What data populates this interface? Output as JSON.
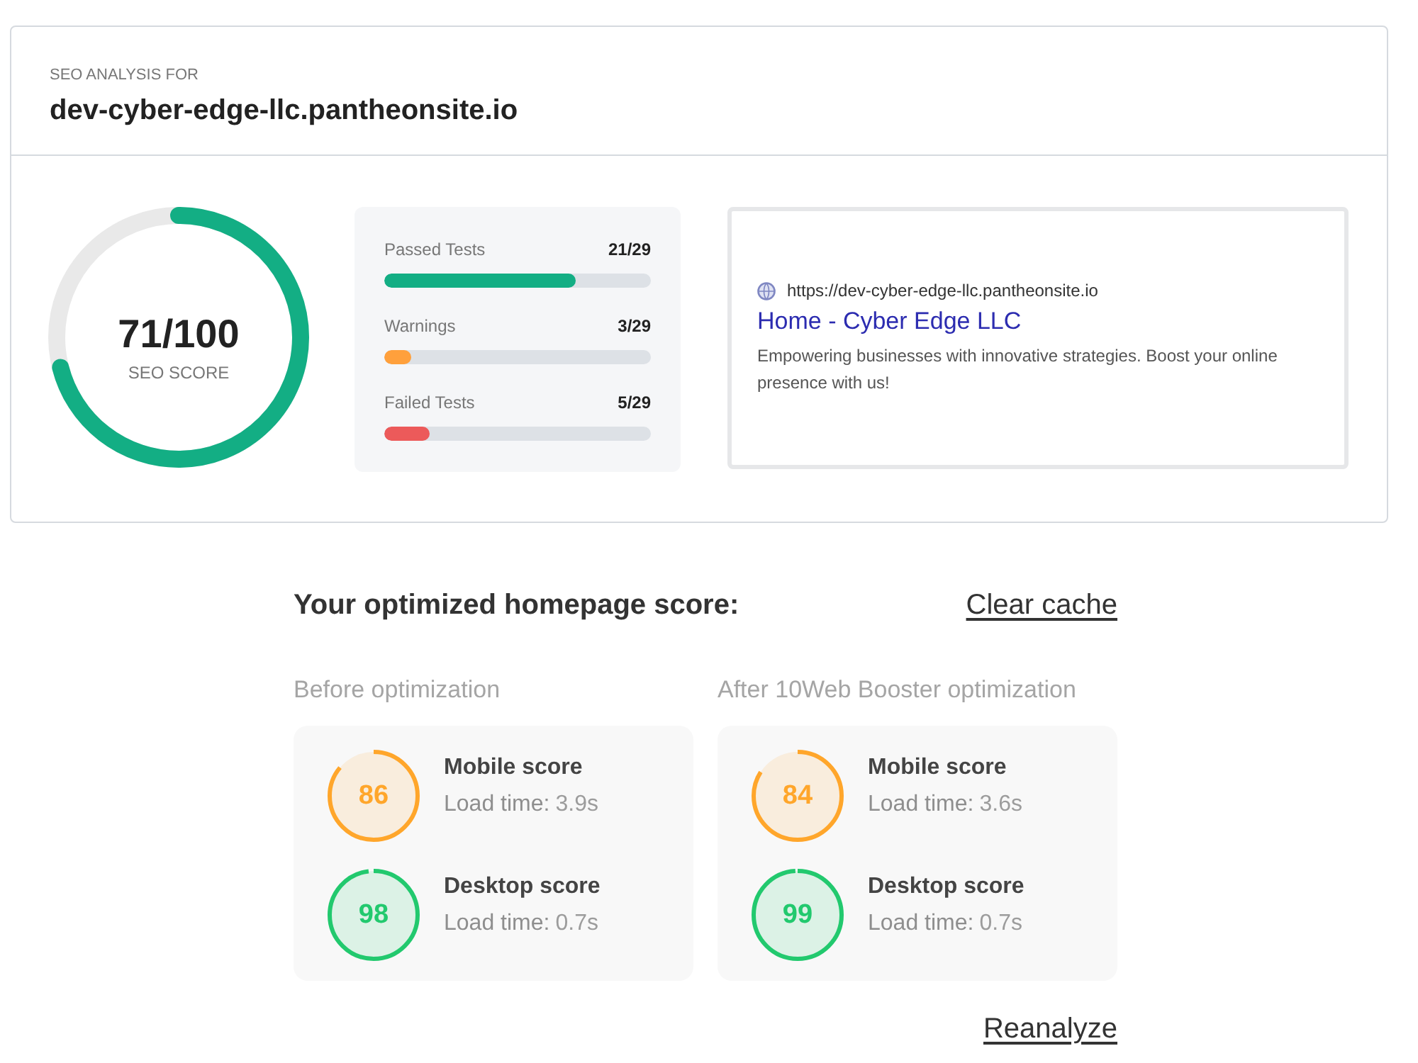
{
  "header": {
    "label": "SEO ANALYSIS FOR",
    "domain": "dev-cyber-edge-llc.pantheonsite.io"
  },
  "seo_score": {
    "value": "71/100",
    "label": "SEO SCORE",
    "level": 0.71
  },
  "stats": [
    {
      "label": "Passed Tests",
      "value": "21/29",
      "level": 0.72,
      "color": "#13ae84"
    },
    {
      "label": "Warnings",
      "value": "3/29",
      "level": 0.1,
      "color": "#ffa03c"
    },
    {
      "label": "Failed Tests",
      "value": "5/29",
      "level": 0.17,
      "color": "#ec5a5a"
    }
  ],
  "search_preview": {
    "url": "https://dev-cyber-edge-llc.pantheonsite.io",
    "title": "Home - Cyber Edge LLC",
    "description": "Empowering businesses with innovative strategies. Boost your online presence with us!"
  },
  "optimized": {
    "title": "Your optimized homepage score:",
    "clear_cache": "Clear cache",
    "columns": [
      {
        "heading": "Before optimization",
        "scores": [
          {
            "score": "86",
            "level": 0.86,
            "color": "#ffa62b",
            "label": "Mobile score",
            "load_time_label": "Load time:",
            "load_time": "3.9s"
          },
          {
            "score": "98",
            "level": 0.98,
            "color": "#22c96e",
            "label": "Desktop score",
            "load_time_label": "Load time:",
            "load_time": "0.7s"
          }
        ]
      },
      {
        "heading": "After 10Web Booster optimization",
        "scores": [
          {
            "score": "84",
            "level": 0.84,
            "color": "#ffa62b",
            "label": "Mobile score",
            "load_time_label": "Load time:",
            "load_time": "3.6s"
          },
          {
            "score": "99",
            "level": 0.99,
            "color": "#22c96e",
            "label": "Desktop score",
            "load_time_label": "Load time:",
            "load_time": "0.7s"
          }
        ]
      }
    ],
    "reanalyze": "Reanalyze"
  }
}
